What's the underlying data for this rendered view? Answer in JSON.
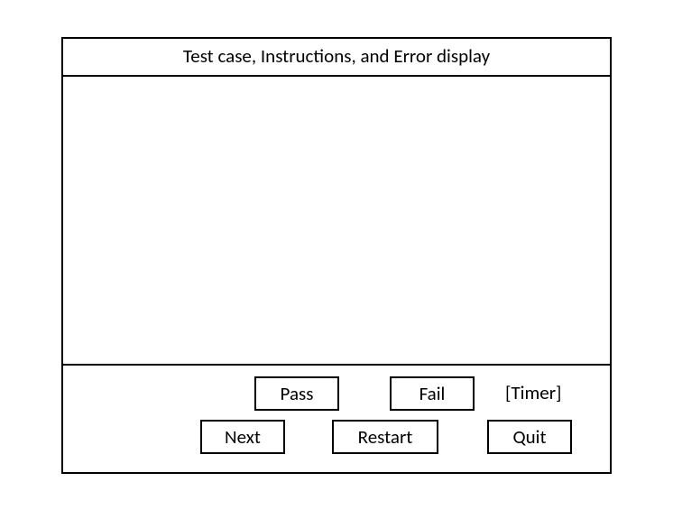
{
  "header": {
    "title": "Test case, Instructions, and Error display"
  },
  "controls": {
    "pass_label": "Pass",
    "fail_label": "Fail",
    "timer_label": "[Timer]",
    "next_label": "Next",
    "restart_label": "Restart",
    "quit_label": "Quit"
  }
}
